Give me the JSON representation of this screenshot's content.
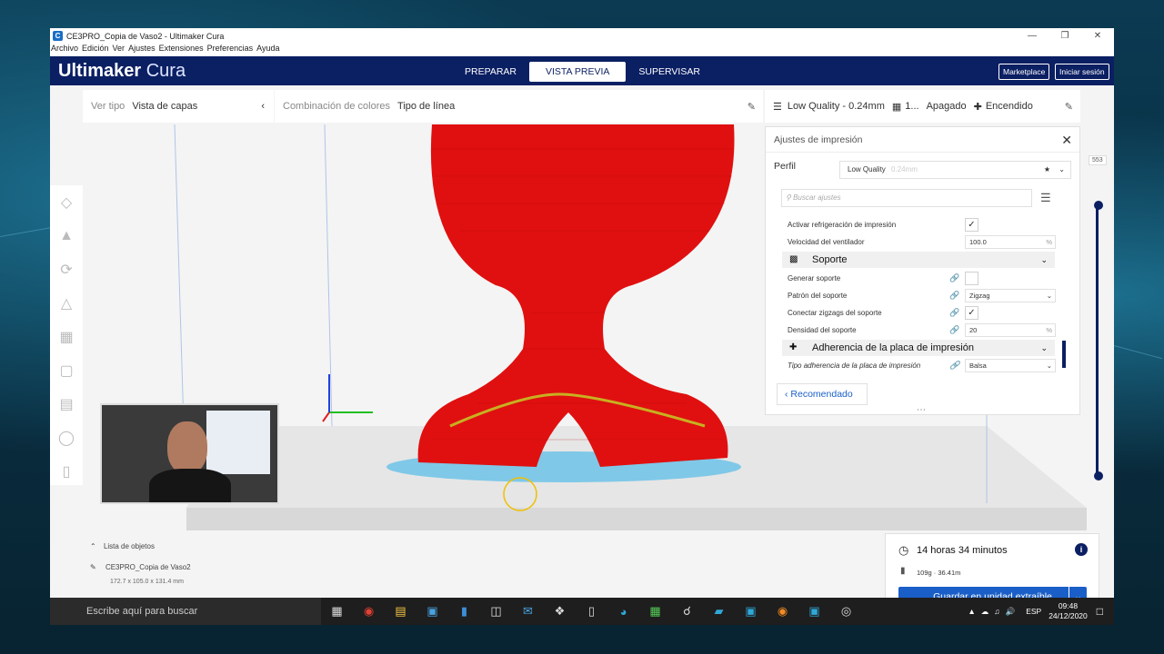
{
  "window": {
    "title": "CE3PRO_Copia de Vaso2 - Ultimaker Cura",
    "menu": [
      "Archivo",
      "Edición",
      "Ver",
      "Ajustes",
      "Extensiones",
      "Preferencias",
      "Ayuda"
    ]
  },
  "header": {
    "brand_main": "Ultimaker",
    "brand_sub": "Cura",
    "stages": [
      "PREPARAR",
      "VISTA PREVIA",
      "SUPERVISAR"
    ],
    "active_stage": "VISTA PREVIA",
    "marketplace": "Marketplace",
    "login": "Iniciar sesión"
  },
  "view_bar": {
    "view_type_label": "Ver tipo",
    "view_type_value": "Vista de capas",
    "color_scheme_label": "Combinación de colores",
    "color_scheme_value": "Tipo de línea"
  },
  "print_bar": {
    "quality": "Low Quality - 0.24mm",
    "infill": "1...",
    "support": "Apagado",
    "adhesion": "Encendido"
  },
  "settings_panel": {
    "title": "Ajustes de impresión",
    "profile_label": "Perfil",
    "profile_value": "Low Quality",
    "profile_suffix": "0.24mm",
    "search_placeholder": "Buscar ajustes",
    "settings": {
      "cooling_label": "Activar refrigeración de impresión",
      "fan_speed_label": "Velocidad del ventilador",
      "fan_speed_value": "100.0",
      "fan_speed_unit": "%",
      "support_category": "Soporte",
      "generate_support_label": "Generar soporte",
      "support_pattern_label": "Patrón del soporte",
      "support_pattern_value": "Zigzag",
      "connect_zigzags_label": "Conectar zigzags del soporte",
      "support_density_label": "Densidad del soporte",
      "support_density_value": "20",
      "support_density_unit": "%",
      "adhesion_category": "Adherencia de la placa de impresión",
      "adhesion_type_label": "Tipo adherencia de la placa de impresión",
      "adhesion_type_value": "Balsa"
    },
    "recommended": "Recomendado"
  },
  "layer_slider": {
    "max_layer": "553"
  },
  "estimate": {
    "time": "14 horas 34 minutos",
    "material": "109g · 36.41m",
    "save_button": "Guardar en unidad extraíble"
  },
  "objects": {
    "list_label": "Lista de objetos",
    "object_name": "CE3PRO_Copia de Vaso2",
    "dimensions": "172.7 x 105.0 x 131.4 mm"
  },
  "taskbar": {
    "search_text": "Escribe aquí para buscar",
    "language": "ESP",
    "time": "09:48",
    "date": "24/12/2020"
  },
  "colors": {
    "brand_blue": "#0b1f63",
    "accent_blue": "#1a5fc7",
    "model_red": "#e01010",
    "support_blue": "#7fc8e8"
  }
}
